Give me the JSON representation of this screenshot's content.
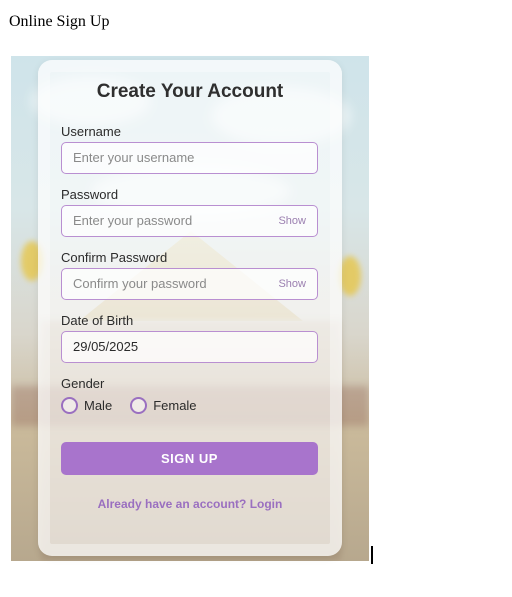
{
  "page": {
    "heading": "Online Sign Up"
  },
  "form": {
    "title": "Create Your Account",
    "username": {
      "label": "Username",
      "placeholder": "Enter your username"
    },
    "password": {
      "label": "Password",
      "placeholder": "Enter your password",
      "toggle_label": "Show"
    },
    "confirm_password": {
      "label": "Confirm Password",
      "placeholder": "Confirm your password",
      "toggle_label": "Show"
    },
    "date_of_birth": {
      "label": "Date of Birth",
      "value": "29/05/2025"
    },
    "gender": {
      "label": "Gender",
      "options": [
        "Male",
        "Female"
      ]
    },
    "submit_label": "SIGN UP",
    "login_prompt": "Already have an account? Login"
  },
  "colors": {
    "accent": "#a874cc",
    "input_border": "#b98fd1",
    "link": "#9a6fc0"
  }
}
